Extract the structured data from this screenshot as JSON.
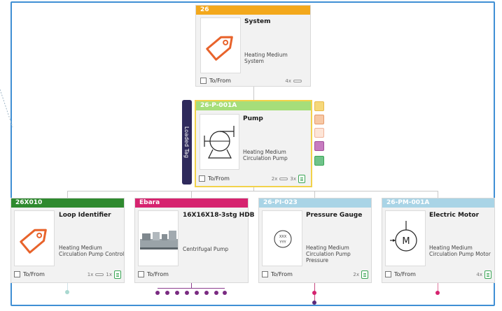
{
  "banner": {
    "label": "Loaded Tag"
  },
  "system_card": {
    "tag": "26",
    "title": "System",
    "description": "Heating Medium System",
    "to_from": "To/From",
    "links": "4x"
  },
  "pump_card": {
    "tag": "26-P-001A",
    "title": "Pump",
    "description": "Heating Medium Circulation Pump",
    "to_from": "To/From",
    "links": "2x",
    "docs": "3x"
  },
  "children": [
    {
      "tag": "26X010",
      "title": "Loop Identifier",
      "description": "Heating Medium Circulation Pump Control",
      "to_from": "To/From",
      "links": "1x",
      "docs": "1x",
      "color": "#2f8a2f"
    },
    {
      "tag": "Ebara",
      "title": "16X16X18-3stg HDB",
      "description": "Centrifugal Pump",
      "to_from": "To/From",
      "links": "",
      "docs": "",
      "color": "#d6236f"
    },
    {
      "tag": "26-PI-023",
      "title": "Pressure Gauge",
      "description": "Heating Medium Circulation Pump Pressure",
      "to_from": "To/From",
      "links": "2x",
      "docs": "",
      "color": "#a9d4e6"
    },
    {
      "tag": "26-PM-001A",
      "title": "Electric Motor",
      "description": "Heating Medium Circulation Pump Motor",
      "to_from": "To/From",
      "links": "4x",
      "docs": "",
      "color": "#a9d4e6"
    }
  ],
  "icons": {
    "system": "tag-icon",
    "pump": "pump-symbol-icon",
    "loop": "tag-icon",
    "ebara": "equipment-photo",
    "gauge": "gauge-symbol-icon",
    "motor": "motor-symbol-icon"
  },
  "gauge_symbol_text": [
    "XXX",
    "YYY"
  ],
  "motor_symbol_text": "M",
  "colors": {
    "frame": "#3f8fd4",
    "system_header": "#f3a81c",
    "pump_header": "#a6de7a",
    "highlight_border": "#f2d24a",
    "loaded_banner": "#2f2a5c"
  }
}
